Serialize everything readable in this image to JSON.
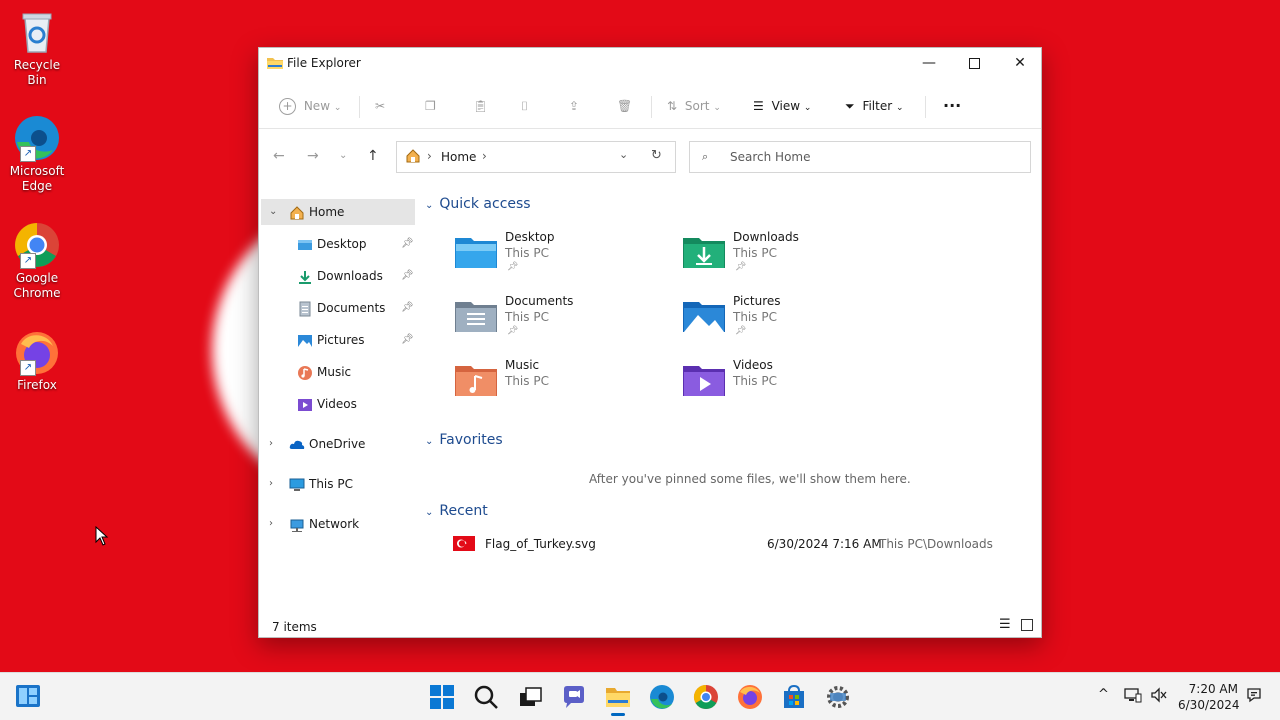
{
  "desktop": {
    "icons": [
      {
        "label": "Recycle Bin"
      },
      {
        "label": "Microsoft Edge"
      },
      {
        "label": "Google Chrome"
      },
      {
        "label": "Firefox"
      }
    ]
  },
  "window": {
    "title": "File Explorer",
    "toolbar": {
      "new_label": "New",
      "sort_label": "Sort",
      "view_label": "View",
      "filter_label": "Filter",
      "more_label": "···"
    },
    "address": {
      "location": "Home"
    },
    "search": {
      "placeholder": "Search Home"
    },
    "sidebar": {
      "items": [
        {
          "label": "Home"
        },
        {
          "label": "Desktop"
        },
        {
          "label": "Downloads"
        },
        {
          "label": "Documents"
        },
        {
          "label": "Pictures"
        },
        {
          "label": "Music"
        },
        {
          "label": "Videos"
        },
        {
          "label": "OneDrive"
        },
        {
          "label": "This PC"
        },
        {
          "label": "Network"
        }
      ]
    },
    "quick_access": {
      "heading": "Quick access",
      "folders": [
        {
          "name": "Desktop",
          "location": "This PC"
        },
        {
          "name": "Downloads",
          "location": "This PC"
        },
        {
          "name": "Documents",
          "location": "This PC"
        },
        {
          "name": "Pictures",
          "location": "This PC"
        },
        {
          "name": "Music",
          "location": "This PC"
        },
        {
          "name": "Videos",
          "location": "This PC"
        }
      ]
    },
    "favorites": {
      "heading": "Favorites",
      "empty_text": "After you've pinned some files, we'll show them here."
    },
    "recent": {
      "heading": "Recent",
      "files": [
        {
          "name": "Flag_of_Turkey.svg",
          "date": "6/30/2024 7:16 AM",
          "location": "This PC\\Downloads"
        }
      ]
    },
    "status": {
      "item_count": "7 items"
    }
  },
  "taskbar": {
    "time": "7:20 AM",
    "date": "6/30/2024"
  },
  "colors": {
    "desktop_bg": "#e30a17",
    "accent": "#0067c0",
    "section_heading": "#1e4b8f"
  }
}
